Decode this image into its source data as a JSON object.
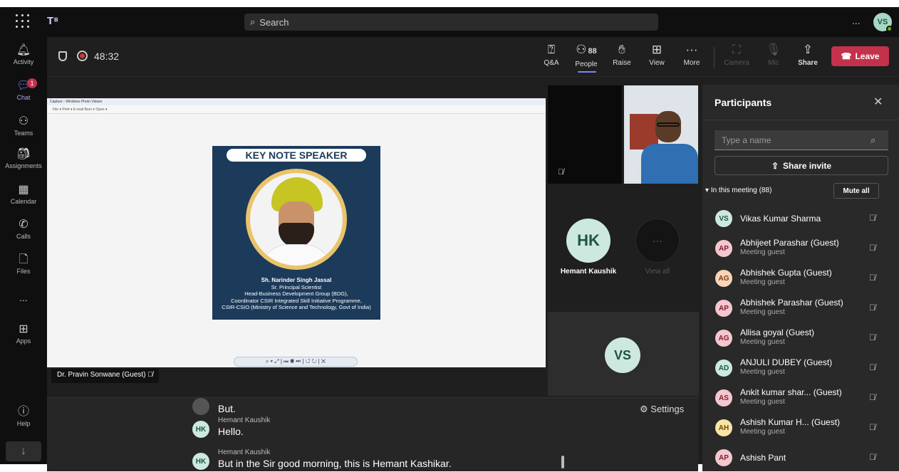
{
  "topbar": {
    "search_placeholder": "Search",
    "more": "...",
    "user_initials": "VS"
  },
  "rail": {
    "items": [
      {
        "label": "Activity",
        "icon": "bell-icon"
      },
      {
        "label": "Chat",
        "icon": "chat-icon",
        "badge": "1"
      },
      {
        "label": "Teams",
        "icon": "teams-icon"
      },
      {
        "label": "Assignments",
        "icon": "assignments-icon"
      },
      {
        "label": "Calendar",
        "icon": "calendar-icon"
      },
      {
        "label": "Calls",
        "icon": "phone-icon"
      },
      {
        "label": "Files",
        "icon": "file-icon"
      },
      {
        "label": "...",
        "icon": "more-icon"
      },
      {
        "label": "Apps",
        "icon": "apps-icon"
      },
      {
        "label": "Help",
        "icon": "help-icon"
      }
    ]
  },
  "meeting": {
    "timer": "48:32",
    "toolbar": {
      "qa": "Q&A",
      "people": "People",
      "people_count": "88",
      "raise": "Raise",
      "view": "View",
      "more": "More",
      "camera": "Camera",
      "mic": "Mic",
      "share": "Share",
      "leave": "Leave"
    }
  },
  "stage": {
    "viewer_title": "Capture - Windows Photo Viewer",
    "viewer_menu": "File ▾  Print ▾  E-mail  Burn ▾  Open ▾",
    "poster_title": "KEY NOTE SPEAKER",
    "speaker_name": "Sh. Narinder Singh Jassal",
    "speaker_line1": "Sr. Principal Scientist",
    "speaker_line2": "Head-Business Development Group (BDG),",
    "speaker_line3": "Coordinator CSIR Integrated Skill Initiative Programme,",
    "speaker_line4": "CSIR-CSIO (Ministry of Science and Technology, Govt of India)",
    "presenter": "Dr. Pravin Sonwane (Guest)"
  },
  "tiles": {
    "hk_initials": "HK",
    "hk_name": "Hemant Kaushik",
    "view_all": "View all",
    "vs_initials": "VS"
  },
  "captions": {
    "settings": "Settings",
    "lines": [
      {
        "speaker": "",
        "initials": "",
        "text": "But."
      },
      {
        "speaker": "Hemant Kaushik",
        "initials": "HK",
        "text": "Hello."
      },
      {
        "speaker": "Hemant Kaushik",
        "initials": "HK",
        "text": "But in the Sir good morning, this is Hemant Kashikar."
      }
    ]
  },
  "participants": {
    "title": "Participants",
    "search_placeholder": "Type a name",
    "share_invite": "Share invite",
    "in_meeting": "In this meeting (88)",
    "mute_all": "Mute all",
    "people": [
      {
        "initials": "VS",
        "name": "Vikas Kumar Sharma",
        "role": "",
        "bg": "#cde9df",
        "fg": "#1f5443"
      },
      {
        "initials": "AP",
        "name": "Abhijeet Parashar (Guest)",
        "role": "Meeting guest",
        "bg": "#f4c7cf",
        "fg": "#7a1f2e"
      },
      {
        "initials": "AG",
        "name": "Abhishek Gupta (Guest)",
        "role": "Meeting guest",
        "bg": "#f8d5b8",
        "fg": "#7a3a10"
      },
      {
        "initials": "AP",
        "name": "Abhishek Parashar (Guest)",
        "role": "Meeting guest",
        "bg": "#f4c7cf",
        "fg": "#7a1f2e"
      },
      {
        "initials": "AG",
        "name": "Allisa goyal (Guest)",
        "role": "Meeting guest",
        "bg": "#f4c7cf",
        "fg": "#7a1f2e"
      },
      {
        "initials": "AD",
        "name": "ANJULI DUBEY (Guest)",
        "role": "Meeting guest",
        "bg": "#cde9df",
        "fg": "#1f5443"
      },
      {
        "initials": "AS",
        "name": "Ankit kumar shar... (Guest)",
        "role": "Meeting guest",
        "bg": "#f4c7cf",
        "fg": "#7a1f2e"
      },
      {
        "initials": "AH",
        "name": "Ashish Kumar H...  (Guest)",
        "role": "Meeting guest",
        "bg": "#fbe3a6",
        "fg": "#6b4b00"
      },
      {
        "initials": "AP",
        "name": "Ashish Pant",
        "role": "",
        "bg": "#f4c7cf",
        "fg": "#7a1f2e"
      }
    ]
  }
}
